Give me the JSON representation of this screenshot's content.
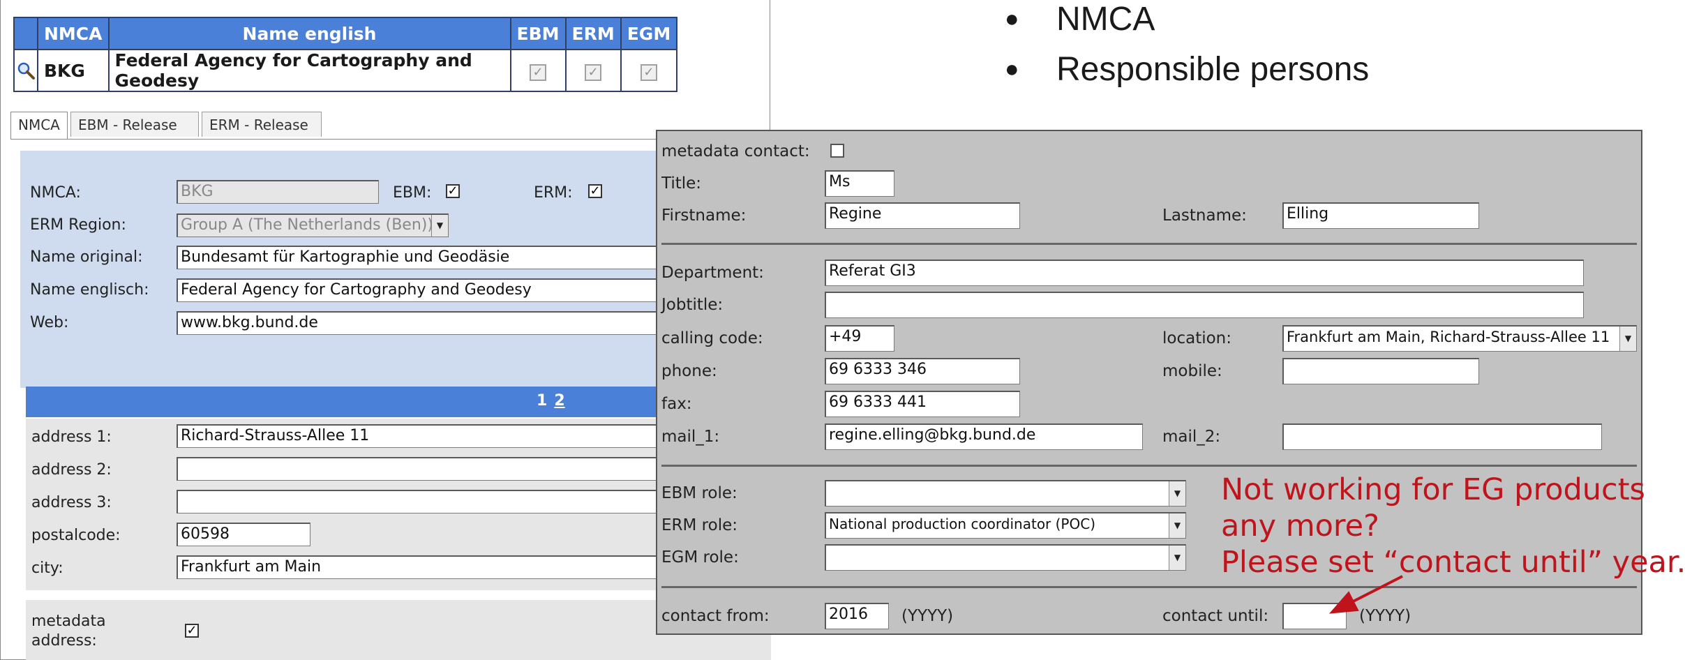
{
  "top_table": {
    "headers": [
      "NMCA",
      "Name english",
      "EBM",
      "ERM",
      "EGM"
    ],
    "row": {
      "nmca": "BKG",
      "name": "Federal Agency for Cartography and Geodesy",
      "ebm": true,
      "erm": true,
      "egm": true
    }
  },
  "tabs": [
    "NMCA",
    "EBM - Release",
    "ERM - Release"
  ],
  "nmca_form": {
    "nmca_label": "NMCA:",
    "nmca_value": "BKG",
    "ebm_label": "EBM:",
    "erm_label": "ERM:",
    "erm_region_label": "ERM Region:",
    "erm_region_value": "Group A (The Netherlands (Ben))",
    "name_original_label": "Name original:",
    "name_original_value": "Bundesamt für Kartographie und Geodäsie",
    "name_english_label": "Name englisch:",
    "name_english_value": "Federal Agency for Cartography and Geodesy",
    "web_label": "Web:",
    "web_value": "www.bkg.bund.de"
  },
  "pager": {
    "page1": "1",
    "page2": "2"
  },
  "address_form": {
    "address1_label": "address 1:",
    "address1_value": "Richard-Strauss-Allee 11",
    "address2_label": "address 2:",
    "address2_value": "",
    "address3_label": "address 3:",
    "address3_value": "",
    "postalcode_label": "postalcode:",
    "postalcode_value": "60598",
    "city_label": "city:",
    "city_value": "Frankfurt am Main",
    "metadata_label_line1": "metadata",
    "metadata_label_line2": "address:"
  },
  "person_form": {
    "metadata_contact_label": "metadata contact:",
    "title_label": "Title:",
    "title_value": "Ms",
    "firstname_label": "Firstname:",
    "firstname_value": "Regine",
    "lastname_label": "Lastname:",
    "lastname_value": "Elling",
    "department_label": "Department:",
    "department_value": "Referat GI3",
    "jobtitle_label": "Jobtitle:",
    "jobtitle_value": "",
    "calling_code_label": "calling code:",
    "calling_code_value": "+49",
    "location_label": "location:",
    "location_value": "Frankfurt am Main, Richard-Strauss-Allee 11",
    "phone_label": "phone:",
    "phone_value": "69 6333 346",
    "mobile_label": "mobile:",
    "mobile_value": "",
    "fax_label": "fax:",
    "fax_value": "69 6333 441",
    "mail1_label": "mail_1:",
    "mail1_value": "regine.elling@bkg.bund.de",
    "mail2_label": "mail_2:",
    "mail2_value": "",
    "ebm_role_label": "EBM role:",
    "ebm_role_value": "",
    "erm_role_label": "ERM role:",
    "erm_role_value": "National production coordinator (POC)",
    "egm_role_label": "EGM role:",
    "egm_role_value": "",
    "contact_from_label": "contact from:",
    "contact_from_value": "2016",
    "yyyy_hint": "(YYYY)",
    "contact_until_label": "contact until:",
    "contact_until_value": ""
  },
  "bullets": [
    "NMCA",
    "Responsible persons"
  ],
  "annotation": {
    "line1": "Not working for EG products",
    "line2": "any more?",
    "line3": "Please set “contact until” year.",
    "color": "#c0141c"
  }
}
